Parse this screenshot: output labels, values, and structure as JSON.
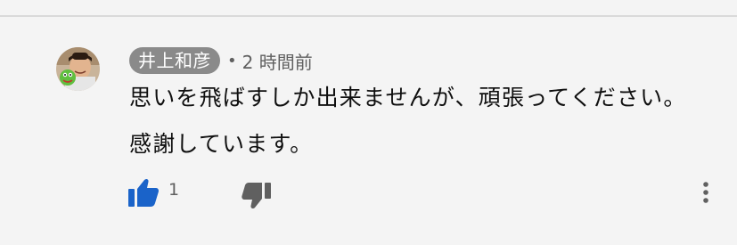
{
  "comment": {
    "author": "井上和彦",
    "separator": "•",
    "timestamp": "2 時間前",
    "text": "思いを飛ばすしか出来ませんが、頑張ってください。感謝しています。",
    "like_count": "1"
  },
  "icons": {
    "like": "thumbs-up-icon",
    "dislike": "thumbs-down-icon",
    "more": "vertical-dots-icon",
    "avatar": "avatar"
  },
  "colors": {
    "background": "#f4f4f4",
    "author_chip": "#8a8a8a",
    "like_active": "#1a63c9",
    "icon_muted": "#606060",
    "text": "#0f0f0f"
  }
}
